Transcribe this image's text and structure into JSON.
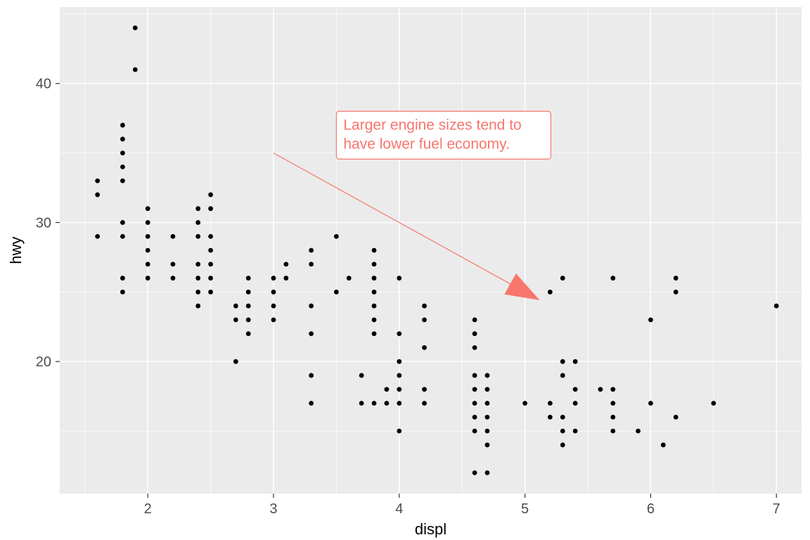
{
  "chart_data": {
    "type": "scatter",
    "title": "",
    "xlabel": "displ",
    "ylabel": "hwy",
    "xlim": [
      1.3,
      7.2
    ],
    "ylim": [
      10.5,
      45.5
    ],
    "x_ticks": [
      2,
      3,
      4,
      5,
      6,
      7
    ],
    "y_ticks": [
      20,
      30,
      40
    ],
    "annotation": {
      "text_line1": "Larger engine sizes tend to",
      "text_line2": "have lower fuel economy.",
      "label_x": 3.5,
      "label_y": 38,
      "arrow_from": [
        3,
        35
      ],
      "arrow_to": [
        5,
        25
      ]
    },
    "points": [
      [
        1.6,
        33
      ],
      [
        1.6,
        32
      ],
      [
        1.6,
        29
      ],
      [
        1.8,
        36
      ],
      [
        1.8,
        37
      ],
      [
        1.8,
        35
      ],
      [
        1.8,
        34
      ],
      [
        1.8,
        33
      ],
      [
        1.8,
        30
      ],
      [
        1.8,
        29
      ],
      [
        1.8,
        26
      ],
      [
        1.8,
        25
      ],
      [
        1.9,
        44
      ],
      [
        1.9,
        41
      ],
      [
        2.0,
        31
      ],
      [
        2.0,
        30
      ],
      [
        2.0,
        29
      ],
      [
        2.0,
        28
      ],
      [
        2.0,
        27
      ],
      [
        2.0,
        26
      ],
      [
        2.2,
        29
      ],
      [
        2.2,
        27
      ],
      [
        2.2,
        26
      ],
      [
        2.4,
        31
      ],
      [
        2.4,
        30
      ],
      [
        2.4,
        29
      ],
      [
        2.4,
        27
      ],
      [
        2.4,
        26
      ],
      [
        2.4,
        25
      ],
      [
        2.4,
        24
      ],
      [
        2.5,
        32
      ],
      [
        2.5,
        31
      ],
      [
        2.5,
        29
      ],
      [
        2.5,
        28
      ],
      [
        2.5,
        27
      ],
      [
        2.5,
        26
      ],
      [
        2.5,
        25
      ],
      [
        2.7,
        24
      ],
      [
        2.7,
        23
      ],
      [
        2.7,
        20
      ],
      [
        2.8,
        26
      ],
      [
        2.8,
        25
      ],
      [
        2.8,
        24
      ],
      [
        2.8,
        23
      ],
      [
        2.8,
        22
      ],
      [
        3.0,
        26
      ],
      [
        3.0,
        25
      ],
      [
        3.0,
        24
      ],
      [
        3.0,
        23
      ],
      [
        3.1,
        27
      ],
      [
        3.1,
        26
      ],
      [
        3.3,
        28
      ],
      [
        3.3,
        27
      ],
      [
        3.3,
        24
      ],
      [
        3.3,
        22
      ],
      [
        3.3,
        19
      ],
      [
        3.3,
        17
      ],
      [
        3.5,
        29
      ],
      [
        3.5,
        25
      ],
      [
        3.6,
        26
      ],
      [
        3.7,
        19
      ],
      [
        3.7,
        17
      ],
      [
        3.8,
        28
      ],
      [
        3.8,
        27
      ],
      [
        3.8,
        26
      ],
      [
        3.8,
        25
      ],
      [
        3.8,
        24
      ],
      [
        3.8,
        23
      ],
      [
        3.8,
        22
      ],
      [
        3.8,
        17
      ],
      [
        3.9,
        18
      ],
      [
        3.9,
        17
      ],
      [
        4.0,
        26
      ],
      [
        4.0,
        22
      ],
      [
        4.0,
        20
      ],
      [
        4.0,
        19
      ],
      [
        4.0,
        18
      ],
      [
        4.0,
        17
      ],
      [
        4.0,
        15
      ],
      [
        4.2,
        24
      ],
      [
        4.2,
        23
      ],
      [
        4.2,
        21
      ],
      [
        4.2,
        18
      ],
      [
        4.2,
        17
      ],
      [
        4.6,
        23
      ],
      [
        4.6,
        22
      ],
      [
        4.6,
        21
      ],
      [
        4.6,
        19
      ],
      [
        4.6,
        18
      ],
      [
        4.6,
        17
      ],
      [
        4.6,
        16
      ],
      [
        4.6,
        15
      ],
      [
        4.6,
        12
      ],
      [
        4.7,
        19
      ],
      [
        4.7,
        18
      ],
      [
        4.7,
        17
      ],
      [
        4.7,
        16
      ],
      [
        4.7,
        15
      ],
      [
        4.7,
        14
      ],
      [
        4.7,
        12
      ],
      [
        5.0,
        17
      ],
      [
        5.2,
        25
      ],
      [
        5.2,
        17
      ],
      [
        5.2,
        16
      ],
      [
        5.3,
        26
      ],
      [
        5.3,
        20
      ],
      [
        5.3,
        19
      ],
      [
        5.3,
        16
      ],
      [
        5.3,
        15
      ],
      [
        5.3,
        14
      ],
      [
        5.4,
        20
      ],
      [
        5.4,
        18
      ],
      [
        5.4,
        17
      ],
      [
        5.4,
        15
      ],
      [
        5.6,
        18
      ],
      [
        5.7,
        26
      ],
      [
        5.7,
        18
      ],
      [
        5.7,
        17
      ],
      [
        5.7,
        16
      ],
      [
        5.7,
        15
      ],
      [
        5.9,
        15
      ],
      [
        6.0,
        23
      ],
      [
        6.0,
        17
      ],
      [
        6.1,
        14
      ],
      [
        6.2,
        26
      ],
      [
        6.2,
        25
      ],
      [
        6.2,
        16
      ],
      [
        6.5,
        17
      ],
      [
        7.0,
        24
      ]
    ]
  }
}
